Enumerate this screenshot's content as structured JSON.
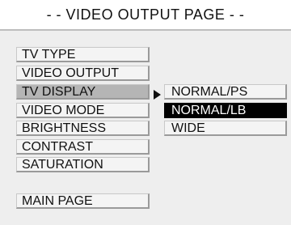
{
  "title": "- - VIDEO OUTPUT PAGE - -",
  "menu": {
    "items": [
      {
        "label": "TV TYPE"
      },
      {
        "label": "VIDEO OUTPUT"
      },
      {
        "label": "TV DISPLAY",
        "selected": true
      },
      {
        "label": "VIDEO MODE"
      },
      {
        "label": "BRIGHTNESS"
      },
      {
        "label": "CONTRAST"
      },
      {
        "label": "SATURATION"
      }
    ],
    "main_page": "MAIN PAGE"
  },
  "submenu": {
    "options": [
      "NORMAL/PS",
      "NORMAL/LB",
      "WIDE"
    ],
    "active": "NORMAL/LB"
  },
  "icons": {
    "submenu_arrow": "right-triangle-icon"
  },
  "colors": {
    "background": "#eeeeee",
    "header_background": "#ffffff",
    "selected_item": "#b5b5b5",
    "active_option_bg": "#000000",
    "active_option_text": "#ffffff"
  }
}
